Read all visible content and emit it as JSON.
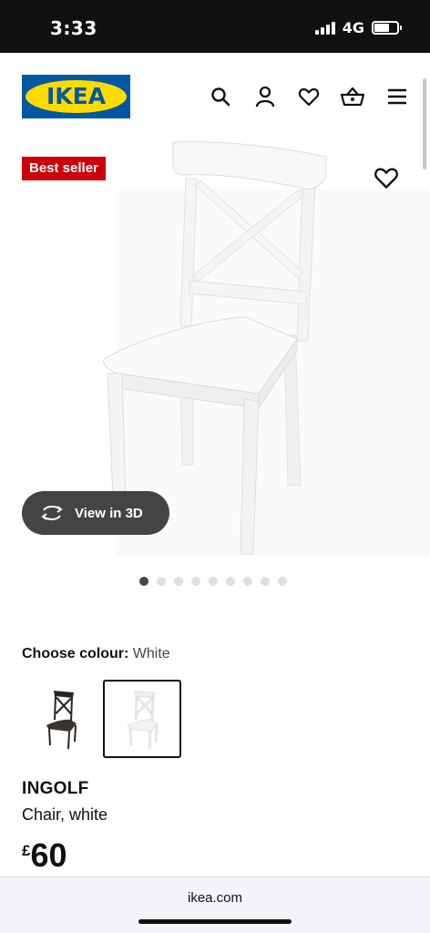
{
  "status_bar": {
    "time": "3:33",
    "network": "4G",
    "battery_level": 0.65
  },
  "header": {
    "logo_text": "IKEA",
    "icons": [
      "search-icon",
      "account-icon",
      "heart-icon",
      "basket-icon",
      "menu-icon"
    ]
  },
  "gallery": {
    "badge": "Best seller",
    "view_3d_label": "View in 3D",
    "image_count": 9,
    "active_index": 0
  },
  "colour": {
    "label": "Choose colour:",
    "value": "White",
    "options": [
      "Black-brown",
      "White"
    ],
    "selected_index": 1
  },
  "product": {
    "name": "INGOLF",
    "description": "Chair, white",
    "currency": "£",
    "price": "60"
  },
  "browser": {
    "url": "ikea.com"
  },
  "colors": {
    "brand_blue": "#0058a3",
    "brand_yellow": "#ffdb00",
    "badge_red": "#cc0008"
  }
}
